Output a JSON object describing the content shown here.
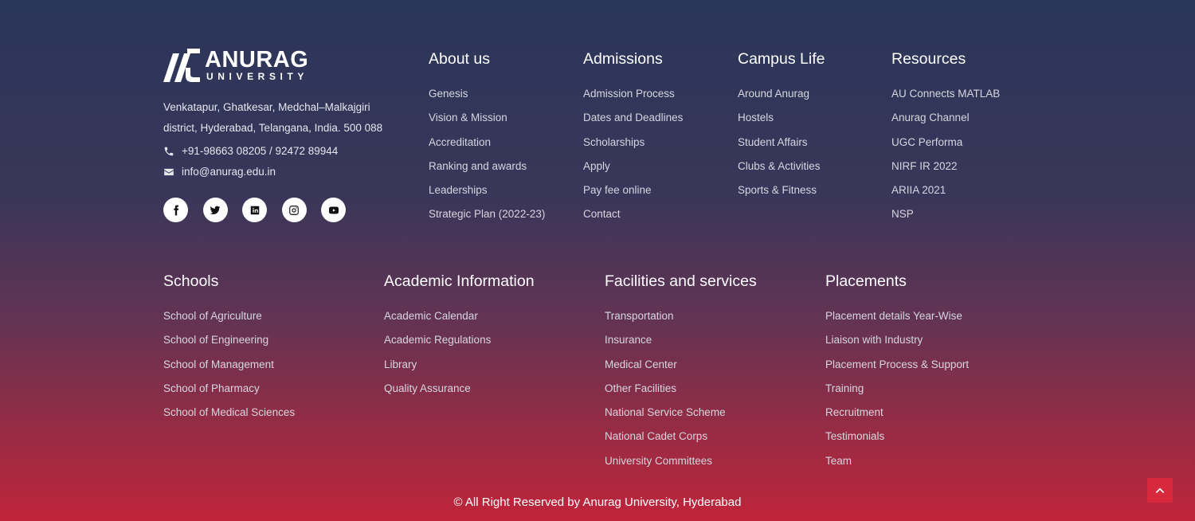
{
  "brand": {
    "name": "ANURAG",
    "sub": "UNIVERSITY",
    "address_line1": "Venkatapur, Ghatkesar, Medchal–Malkajgiri",
    "address_line2": "district, Hyderabad, Telangana, India. 500 088",
    "phone": "+91-98663 08205 / 92472 89944",
    "email": "info@anurag.edu.in",
    "socials": [
      "facebook-icon",
      "twitter-icon",
      "linkedin-icon",
      "instagram-icon",
      "youtube-icon"
    ]
  },
  "top_columns": [
    {
      "title": "About us",
      "links": [
        "Genesis",
        "Vision & Mission",
        "Accreditation",
        "Ranking and awards",
        "Leaderships",
        "Strategic Plan (2022-23)"
      ]
    },
    {
      "title": "Admissions",
      "links": [
        "Admission Process",
        "Dates and Deadlines",
        "Scholarships",
        "Apply",
        "Pay fee online",
        "Contact"
      ]
    },
    {
      "title": "Campus Life",
      "links": [
        "Around Anurag",
        "Hostels",
        "Student Affairs",
        "Clubs & Activities",
        "Sports & Fitness"
      ]
    },
    {
      "title": "Resources",
      "links": [
        "AU Connects MATLAB",
        "Anurag Channel",
        "UGC Performa",
        "NIRF IR 2022",
        "ARIIA 2021",
        "NSP"
      ]
    }
  ],
  "bottom_columns": [
    {
      "title": "Schools",
      "links": [
        "School of Agriculture",
        "School of Engineering",
        "School of Management",
        "School of Pharmacy",
        "School of Medical Sciences"
      ]
    },
    {
      "title": "Academic Information",
      "links": [
        "Academic Calendar",
        "Academic Regulations",
        "Library",
        "Quality Assurance"
      ]
    },
    {
      "title": "Facilities and services",
      "links": [
        "Transportation",
        "Insurance",
        "Medical Center",
        "Other Facilities",
        "National Service Scheme",
        "National Cadet Corps",
        "University Committees"
      ]
    },
    {
      "title": "Placements",
      "links": [
        "Placement details Year-Wise",
        "Liaison with Industry",
        "Placement Process & Support",
        "Training",
        "Recruitment",
        "Testimonials",
        "Team"
      ]
    }
  ],
  "copyright": "© All Right Reserved by Anurag University, Hyderabad",
  "colors": {
    "accent": "#d8283c",
    "bg_top": "#293659",
    "bg_bottom": "#c0243a"
  }
}
